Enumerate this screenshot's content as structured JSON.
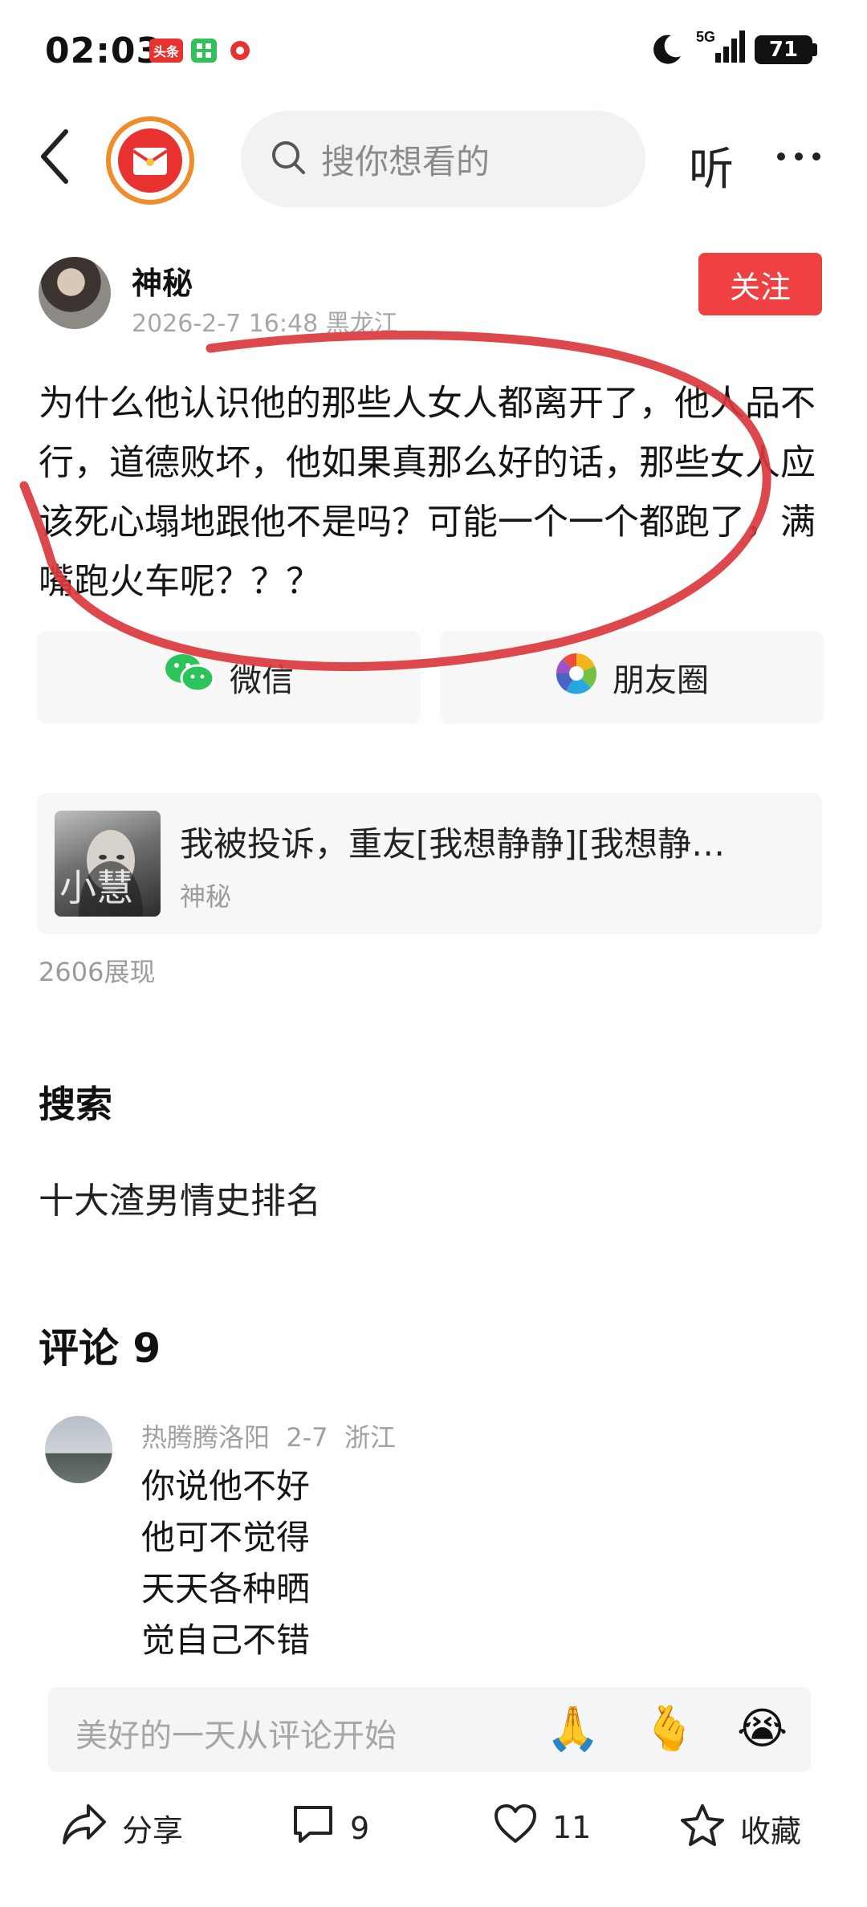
{
  "status_bar": {
    "time": "02:03",
    "app_badge": "头条",
    "network": "5G",
    "battery": "71"
  },
  "nav": {
    "search_placeholder": "搜你想看的",
    "listen_label": "听"
  },
  "author": {
    "name": "神秘",
    "meta": "2026-2-7 16:48 黑龙江",
    "follow_label": "关注"
  },
  "post": {
    "body": "为什么他认识他的那些人女人都离开了，他人品不行，道德败坏，他如果真那么好的话，那些女人应该死心塌地跟他不是吗？可能一个一个都跑了，满嘴跑火车呢？？？"
  },
  "share": {
    "wechat_label": "微信",
    "moments_label": "朋友圈"
  },
  "linked_post": {
    "title": "我被投诉，重友[我想静静][我想静…",
    "author": "神秘",
    "thumb_text": "小慧"
  },
  "views": "2606展现",
  "search_section": {
    "heading": "搜索",
    "suggestion": "十大渣男情史排名"
  },
  "comments": {
    "heading": "评论 9",
    "items": [
      {
        "meta": "热腾腾洛阳  2-7  浙江",
        "lines": [
          "你说他不好",
          "他可不觉得",
          "天天各种晒",
          "觉自己不错"
        ]
      }
    ]
  },
  "input": {
    "placeholder": "美好的一天从评论开始",
    "emojis": [
      "🙏",
      "🫰",
      "😭"
    ]
  },
  "toolbar": {
    "share_label": "分享",
    "comment_count": "9",
    "like_count": "11",
    "favorite_label": "收藏"
  },
  "colors": {
    "accent": "#f04142",
    "annotation": "#d9383c",
    "secondary_text": "#a7a7a7",
    "card_bg": "#f7f7f7"
  }
}
